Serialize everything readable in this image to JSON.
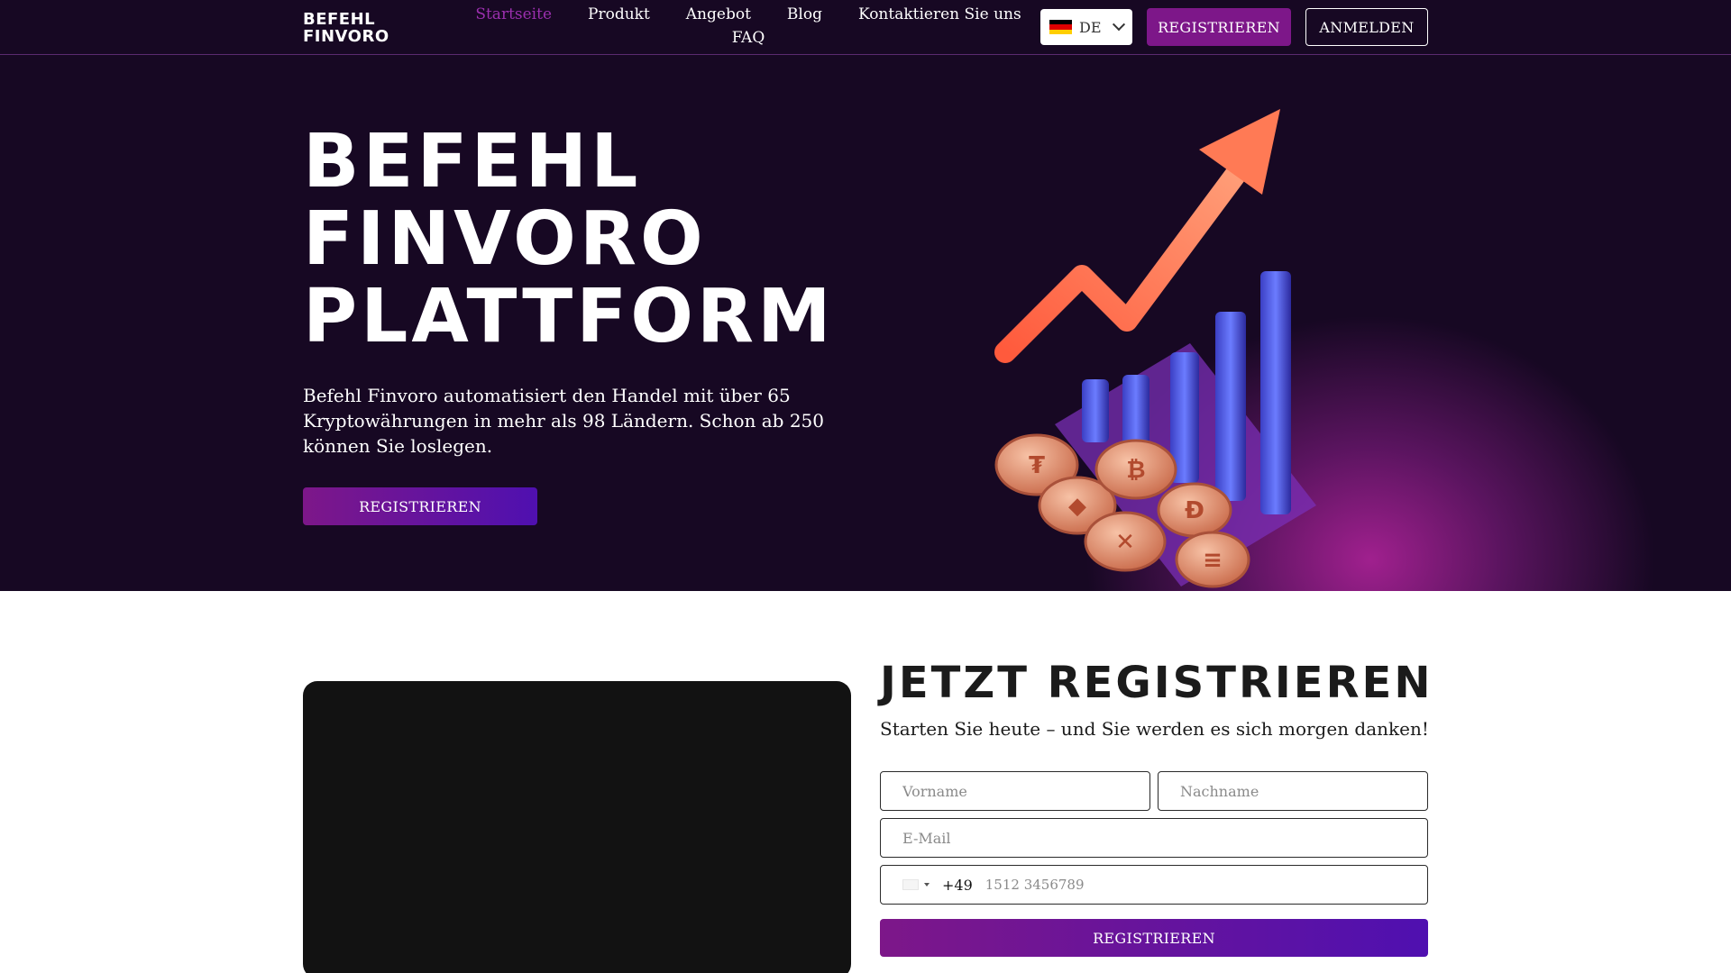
{
  "header": {
    "logo_line1": "BEFEHL",
    "logo_line2": "FINVORO",
    "nav": [
      "Startseite",
      "Produkt",
      "Angebot",
      "Blog",
      "Kontaktieren Sie uns",
      "FAQ"
    ],
    "active_nav": "Startseite",
    "language": "DE",
    "register_label": "REGISTRIEREN",
    "login_label": "ANMELDEN"
  },
  "hero": {
    "title_line1": "BEFEHL",
    "title_line2": "FINVORO",
    "title_line3": "PLATTFORM",
    "description": "Befehl Finvoro automatisiert den Handel mit über 65 Kryptowährungen in mehr als 98 Ländern. Schon ab 250 können Sie loslegen.",
    "register_label": "REGISTRIEREN",
    "coin_symbols": [
      "₮",
      "◆",
      "₿",
      "Ð",
      "✕",
      "≡"
    ]
  },
  "form": {
    "title": "JETZT REGISTRIEREN",
    "subtitle": "Starten Sie heute – und Sie werden es sich morgen danken!",
    "first_name_placeholder": "Vorname",
    "last_name_placeholder": "Nachname",
    "email_placeholder": "E-Mail",
    "phone_code": "+49",
    "phone_placeholder": "1512 3456789",
    "submit_label": "REGISTRIEREN"
  },
  "colors": {
    "hero_bg": "#170823",
    "accent_purple": "#7d1789",
    "accent_violet": "#4f10b0",
    "nav_active": "#9b2fae",
    "arrow": "#ff6b4a",
    "bars": "#4a5be0"
  }
}
